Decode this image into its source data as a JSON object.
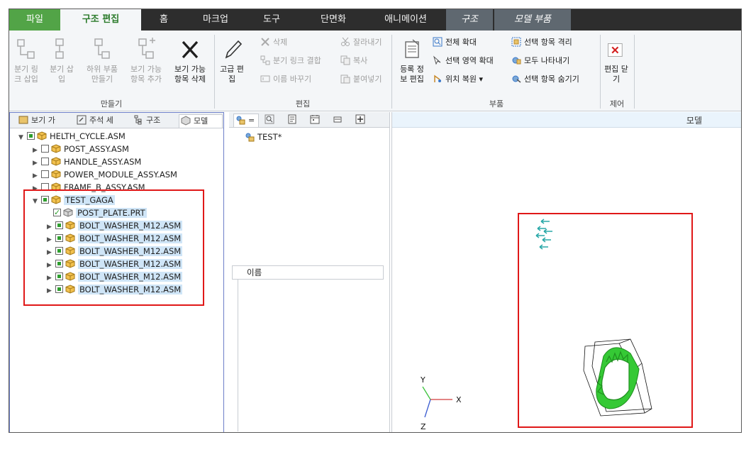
{
  "tabs": [
    {
      "label": "파일"
    },
    {
      "label": "구조 편집"
    },
    {
      "label": "홈"
    },
    {
      "label": "마크업"
    },
    {
      "label": "도구"
    },
    {
      "label": "단면화"
    },
    {
      "label": "애니메이션"
    },
    {
      "label": "구조"
    },
    {
      "label": "모델 부품"
    }
  ],
  "ribbon": {
    "make_group": {
      "label": "만들기",
      "buttons": [
        {
          "line1": "분기 링",
          "line2": "크 삽입"
        },
        {
          "line1": "분기 삽",
          "line2": "입"
        },
        {
          "line1": "하위 부품",
          "line2": "만들기"
        },
        {
          "line1": "보기 가능",
          "line2": "항목 추가"
        },
        {
          "line1": "보기 가능",
          "line2": "항목 삭제"
        }
      ]
    },
    "edit_group": {
      "label": "편집",
      "advanced": {
        "line1": "고급 편",
        "line2": "집"
      },
      "delete": "삭제",
      "break_link": "분기 링크 결합",
      "rename": "이름 바꾸기",
      "cut": "잘라내기",
      "copy": "복사",
      "paste": "붙여넣기"
    },
    "parts_group": {
      "label": "부품",
      "register": {
        "line1": "등록 정",
        "line2": "보 편집"
      },
      "zoom_all": "전체 확대",
      "zoom_selected": "선택 영역 확대",
      "restore_position": "위치 복원",
      "isolate": "선택 항목 격리",
      "show_all": "모두 나타내기",
      "hide_selected": "선택 항목 숨기기"
    },
    "control_group": {
      "label": "제어",
      "close_edit": {
        "line1": "편집 닫",
        "line2": "기"
      }
    }
  },
  "left_panel": {
    "tabs": [
      "보기 가",
      "주석 세",
      "구조",
      "모델"
    ],
    "tree": [
      {
        "label": "HELTH_CYCLE.ASM"
      },
      {
        "label": "POST_ASSY.ASM"
      },
      {
        "label": "HANDLE_ASSY.ASM"
      },
      {
        "label": "POWER_MODULE_ASSY.ASM"
      },
      {
        "label": "FRAME_B_ASSY.ASM"
      },
      {
        "label": "TEST_GAGA"
      },
      {
        "label": "POST_PLATE.PRT"
      },
      {
        "label": "BOLT_WASHER_M12.ASM"
      },
      {
        "label": "BOLT_WASHER_M12.ASM"
      },
      {
        "label": "BOLT_WASHER_M12.ASM"
      },
      {
        "label": "BOLT_WASHER_M12.ASM"
      },
      {
        "label": "BOLT_WASHER_M12.ASM"
      },
      {
        "label": "BOLT_WASHER_M12.ASM"
      }
    ]
  },
  "mid_panel": {
    "tab1_label": "=",
    "item": "TEST*",
    "column_header": "이름"
  },
  "right_panel": {
    "header": "모델",
    "axes": {
      "y": "Y",
      "x": "X",
      "z": "Z"
    }
  },
  "colors": {
    "file_tab": "#52a447",
    "selection_highlight": "#cfe5f7",
    "annotation_red": "#e01818",
    "model_green": "#3dd43d"
  }
}
